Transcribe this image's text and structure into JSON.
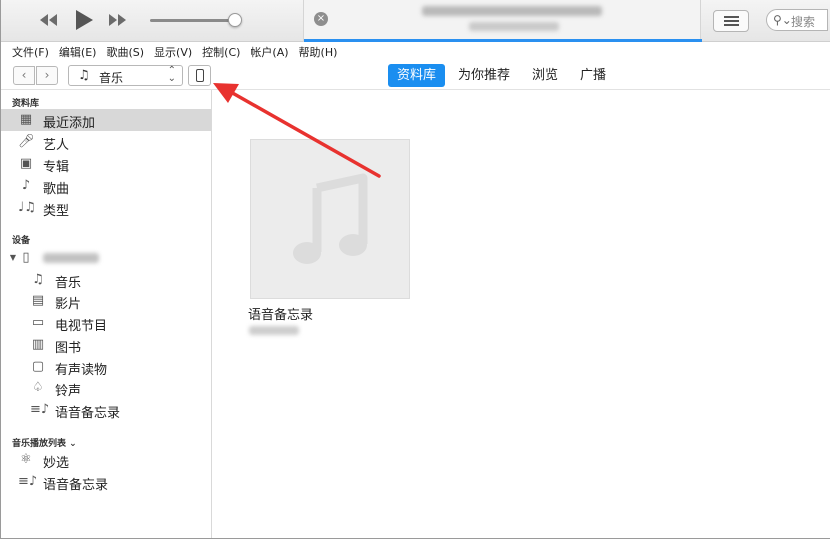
{
  "player": {
    "prev_icon": "rewind-icon",
    "play_icon": "play-icon",
    "next_icon": "fast-forward-icon",
    "close_glyph": "×",
    "list_icon": "list-view-icon"
  },
  "search": {
    "placeholder": "搜索",
    "icon": "search-icon"
  },
  "menu": [
    "文件(F)",
    "编辑(E)",
    "歌曲(S)",
    "显示(V)",
    "控制(C)",
    "帐户(A)",
    "帮助(H)"
  ],
  "nav": {
    "back": "‹",
    "forward": "›",
    "media_type": "音乐",
    "tabs": [
      "资料库",
      "为你推荐",
      "浏览",
      "广播"
    ],
    "active_tab": "资料库"
  },
  "sidebar": {
    "library_header": "资料库",
    "library_items": [
      "最近添加",
      "艺人",
      "专辑",
      "歌曲",
      "类型"
    ],
    "devices_header": "设备",
    "device_items": [
      "音乐",
      "影片",
      "电视节目",
      "图书",
      "有声读物",
      "铃声",
      "语音备忘录"
    ],
    "playlists_header": "音乐播放列表 ⌄",
    "playlist_items": [
      "妙选",
      "语音备忘录"
    ]
  },
  "main": {
    "album_title": "语音备忘录"
  },
  "colors": {
    "accent": "#1a8ef0",
    "annotation_arrow": "#e8322f"
  }
}
